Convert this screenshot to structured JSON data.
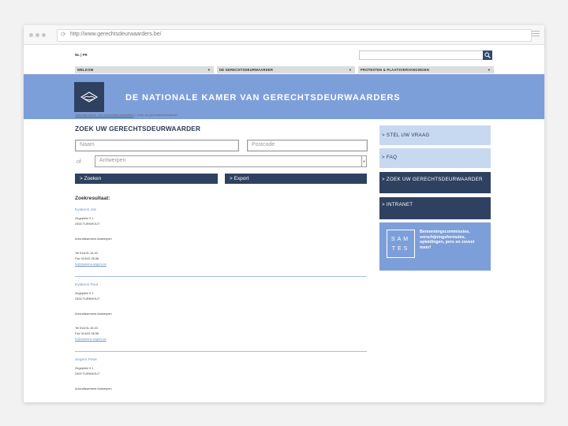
{
  "browser": {
    "url": "http://www.gerechtsdeurwaarders.be/"
  },
  "lang": "NL | FR",
  "nav": [
    {
      "label": "WELKOM"
    },
    {
      "label": "DE GERECHTSDEURWAARDER"
    },
    {
      "label": "PROTESTEN & PLAATSVERVANGINGEN"
    }
  ],
  "banner": {
    "title": "DE NATIONALE KAMER VAN GERECHTSDEURWAARDERS"
  },
  "breadcrumb": {
    "home": "Nationale kamer van Gerechtsdeurwaarders",
    "separator": " > ",
    "current": "Zoek uw gerechtsdeurwaarder"
  },
  "page_title": "ZOEK UW GERECHTSDEURWAARDER",
  "form": {
    "name_placeholder": "Naam",
    "postcode_placeholder": "Postcode",
    "of_label": "of",
    "district_value": "Antwerpen",
    "search_button": "> Zoeken",
    "export_button": "> Export"
  },
  "results_title": "Zoekresultaat:",
  "results": [
    {
      "name": "Eyskens Jos",
      "street": "Zegeplein 9 1",
      "city": "2300 TURNHOUT",
      "district": "Arrondissement Antwerpen",
      "tel": "Tel 014/41.16.43",
      "fax": "Fax 014/42.36.58",
      "email": "fo@eyskens-segers.be"
    },
    {
      "name": "Eyskens Paul",
      "street": "Zegeplein 9 1",
      "city": "2300 TURNHOUT",
      "district": "Arrondissement Antwerpen",
      "tel": "Tel 014/41.16.43",
      "fax": "Fax 014/42.36.58",
      "email": "fo@eyskens-segers.be"
    },
    {
      "name": "Segers Peter",
      "street": "Zegeplein 9 1",
      "city": "2300 TURNHOUT",
      "district": "Arrondissement Antwerpen"
    }
  ],
  "sidebar": [
    {
      "label": "> STEL UW VRAAG"
    },
    {
      "label": "> FAQ"
    },
    {
      "label": "> ZOEK UW GERECHTSDEURWAARDER"
    },
    {
      "label": "> INTRANET"
    }
  ],
  "samtes": {
    "letters_top": "SAM",
    "letters_bottom": "TES",
    "text": "Benoemingscommissies, verschijningsformules, opleidingen, pers en zoveel meer!"
  },
  "colors": {
    "navy": "#2f4160",
    "banner_blue": "#7d9fd9",
    "light_blue": "#c7d8f1",
    "link_blue": "#6b93cf"
  },
  "icons": {
    "reload": "reload-icon",
    "menu": "hamburger-icon",
    "search": "search-icon",
    "logo": "hands-logo-icon"
  }
}
